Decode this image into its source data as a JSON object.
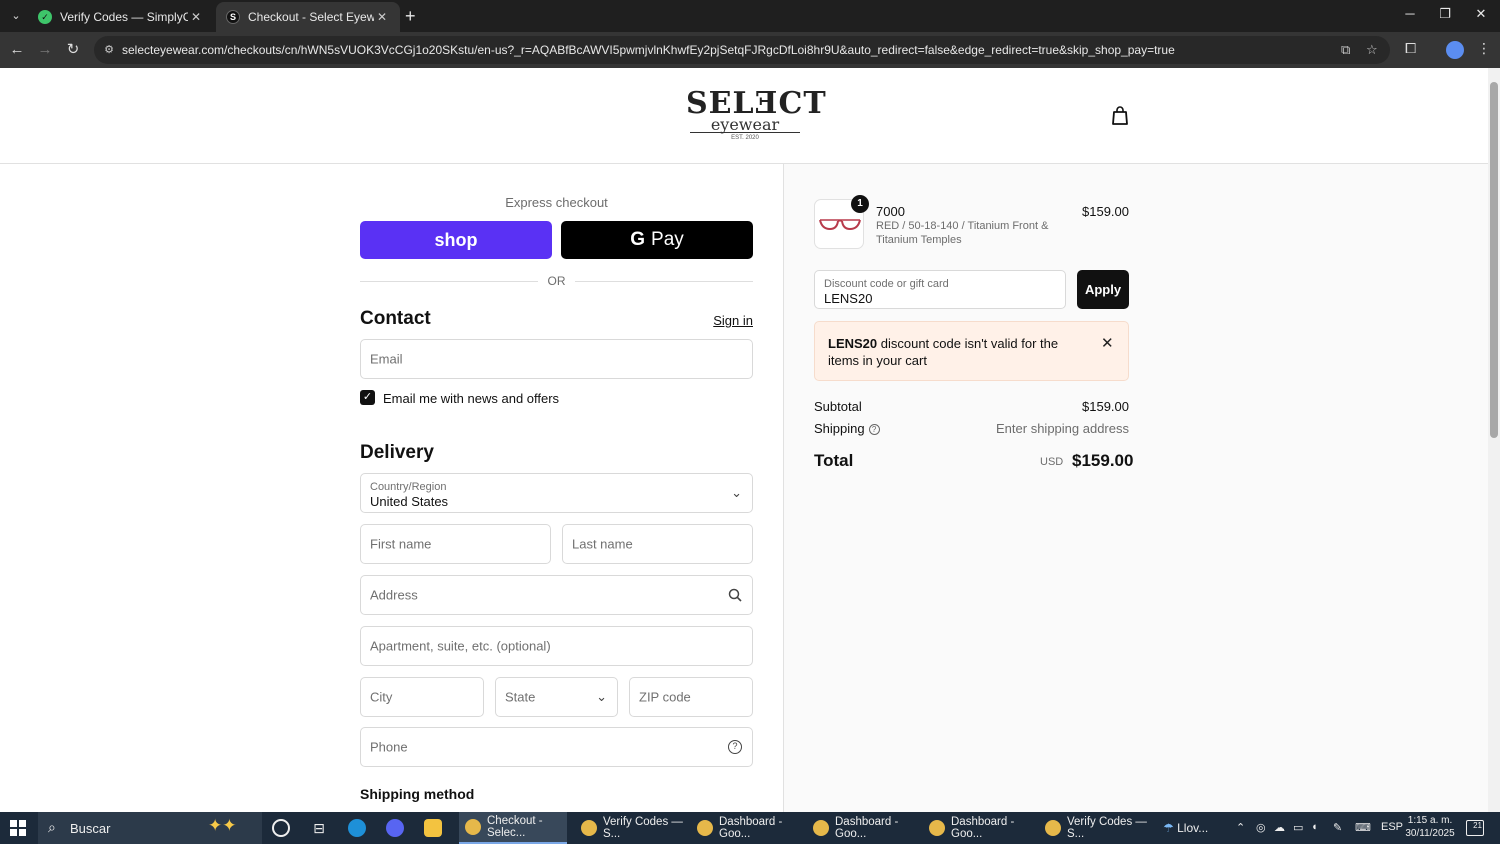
{
  "browser": {
    "tabs": [
      {
        "label": "Verify Codes — SimplyCodes",
        "active": false
      },
      {
        "label": "Checkout - Select Eyewear",
        "active": true
      }
    ],
    "url": "selecteyewear.com/checkouts/cn/hWN5sVUOK3VcCGj1o20SKstu/en-us?_r=AQABfBcAWVI5pwmjvlnKhwfEy2pjSetqFJRgcDfLoi8hr9U&auto_redirect=false&edge_redirect=true&skip_shop_pay=true"
  },
  "header": {
    "logo_main": "SELƎCT",
    "logo_sub": "eyewear",
    "logo_est": "EST. 2020"
  },
  "express": {
    "title": "Express checkout",
    "shop_label": "shop",
    "gpay_g": "G",
    "gpay_label": "Pay",
    "or_label": "OR"
  },
  "contact": {
    "title": "Contact",
    "sign_in": "Sign in",
    "email_placeholder": "Email",
    "news_checked": true,
    "news_label": "Email me with news and offers"
  },
  "delivery": {
    "title": "Delivery",
    "country_label": "Country/Region",
    "country_value": "United States",
    "first_name_placeholder": "First name",
    "last_name_placeholder": "Last name",
    "address_placeholder": "Address",
    "apartment_placeholder": "Apartment, suite, etc. (optional)",
    "city_placeholder": "City",
    "state_placeholder": "State",
    "zip_placeholder": "ZIP code",
    "phone_placeholder": "Phone",
    "shipping_method_title": "Shipping method"
  },
  "summary": {
    "product": {
      "quantity": "1",
      "name": "7000",
      "variant": "RED / 50-18-140 / Titanium Front & Titanium Temples",
      "price": "$159.00"
    },
    "discount_label": "Discount code or gift card",
    "discount_value": "LENS20",
    "apply_label": "Apply",
    "alert_code": "LENS20",
    "alert_message": " discount code isn't valid for the items in your cart",
    "subtotal_label": "Subtotal",
    "subtotal_value": "$159.00",
    "shipping_label": "Shipping",
    "shipping_value": "Enter shipping address",
    "total_label": "Total",
    "total_currency": "USD",
    "total_value": "$159.00"
  },
  "taskbar": {
    "search_label": "Buscar",
    "apps": [
      {
        "label": "Checkout - Selec...",
        "active": true
      },
      {
        "label": "Verify Codes — S...",
        "active": false
      },
      {
        "label": "Dashboard - Goo...",
        "active": false
      },
      {
        "label": "Dashboard - Goo...",
        "active": false
      },
      {
        "label": "Dashboard - Goo...",
        "active": false
      },
      {
        "label": "Verify Codes — S...",
        "active": false
      }
    ],
    "weather_label": "Llov...",
    "language": "ESP",
    "time": "1:15 a. m.",
    "date": "30/11/2025",
    "notifications": "21"
  },
  "colors": {
    "shop_pay": "#5a31f4",
    "alert_bg": "#fff1e8",
    "primary_button": "#111111"
  }
}
